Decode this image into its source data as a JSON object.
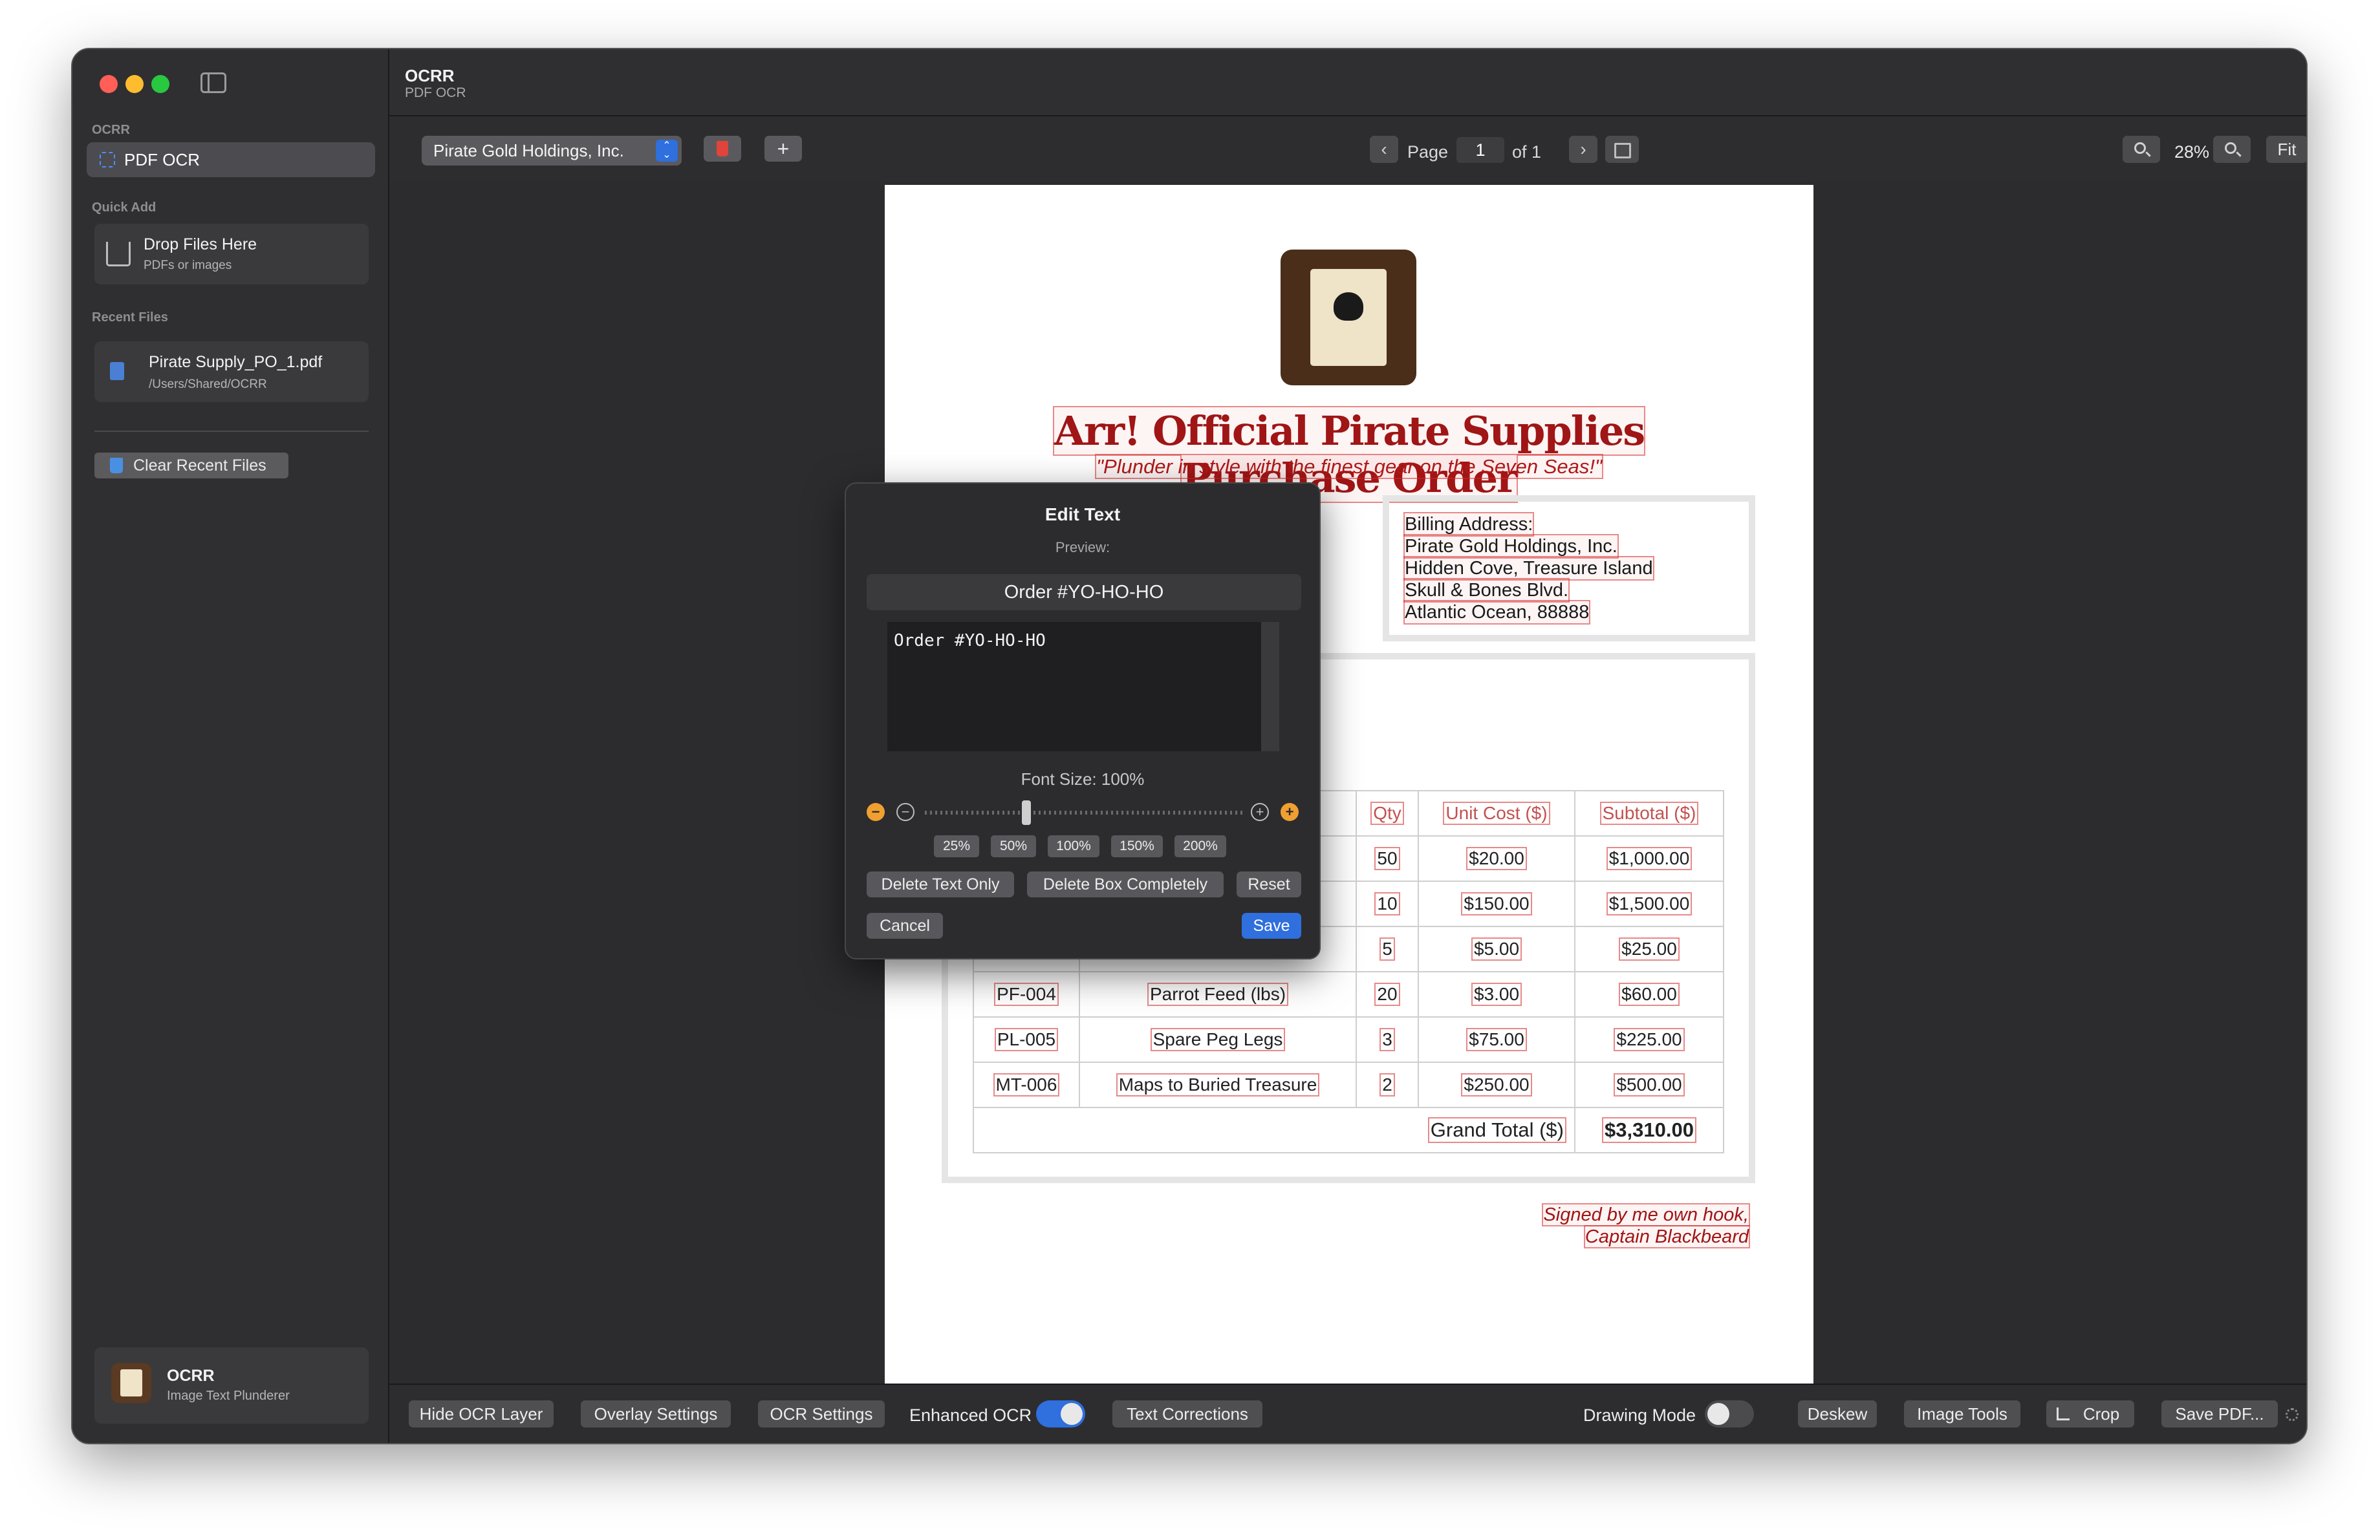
{
  "sidebar": {
    "section_ocrr": "OCRR",
    "nav_pdf_ocr": "PDF OCR",
    "section_quick_add": "Quick Add",
    "drop_title": "Drop Files Here",
    "drop_sub": "PDFs or images",
    "section_recent": "Recent Files",
    "recent_name": "Pirate Supply_PO_1.pdf",
    "recent_path": "/Users/Shared/OCRR",
    "clear_label": "Clear Recent Files",
    "footer_title": "OCRR",
    "footer_sub": "Image Text Plunderer"
  },
  "header": {
    "title": "OCRR",
    "subtitle": "PDF OCR"
  },
  "toolbar": {
    "profile": "Pirate Gold Holdings, Inc.",
    "page_label": "Page",
    "page_value": "1",
    "of_label": "of 1",
    "zoom": "28%",
    "fit_label": "Fit"
  },
  "document": {
    "title": "Arr! Official Pirate Supplies Purchase Order",
    "tagline": "\"Plunder in style with the finest gear on the Seven Seas!\"",
    "billing": [
      "Billing Address:",
      "Pirate Gold Holdings, Inc.",
      "Hidden Cove, Treasure Island",
      "Skull & Bones Blvd.",
      "Atlantic Ocean, 88888"
    ],
    "table": {
      "headers": [
        "",
        "",
        "Qty",
        "Unit Cost ($)",
        "Subtotal ($)"
      ],
      "rows": [
        [
          "",
          "",
          "50",
          "$20.00",
          "$1,000.00"
        ],
        [
          "",
          "",
          "10",
          "$150.00",
          "$1,500.00"
        ],
        [
          "",
          "",
          "5",
          "$5.00",
          "$25.00"
        ],
        [
          "PF-004",
          "Parrot Feed (lbs)",
          "20",
          "$3.00",
          "$60.00"
        ],
        [
          "PL-005",
          "Spare Peg Legs",
          "3",
          "$75.00",
          "$225.00"
        ],
        [
          "MT-006",
          "Maps to Buried Treasure",
          "2",
          "$250.00",
          "$500.00"
        ]
      ],
      "grand_total_label": "Grand Total ($)",
      "grand_total_value": "$3,310.00"
    },
    "signature": [
      "Signed by me own hook,",
      "Captain Blackbeard"
    ]
  },
  "dialog": {
    "title": "Edit Text",
    "preview_label": "Preview:",
    "preview_text": "Order #YO-HO-HO",
    "edit_text": "Order #YO-HO-HO",
    "font_size_label": "Font Size: 100%",
    "font_size_percent": 100,
    "presets": [
      "25%",
      "50%",
      "100%",
      "150%",
      "200%"
    ],
    "delete_text_only": "Delete Text Only",
    "delete_box": "Delete Box Completely",
    "reset": "Reset",
    "cancel": "Cancel",
    "save": "Save"
  },
  "bottombar": {
    "hide_ocr": "Hide OCR Layer",
    "overlay": "Overlay Settings",
    "ocr_settings": "OCR Settings",
    "enhanced_label": "Enhanced OCR",
    "enhanced_on": true,
    "text_corrections": "Text Corrections",
    "drawing_label": "Drawing Mode",
    "drawing_on": false,
    "deskew": "Deskew",
    "image_tools": "Image Tools",
    "crop": "Crop",
    "save_pdf": "Save PDF..."
  },
  "colors": {
    "accent": "#2f6fde",
    "ocr_box": "#d62828",
    "title_red": "#a01515"
  }
}
